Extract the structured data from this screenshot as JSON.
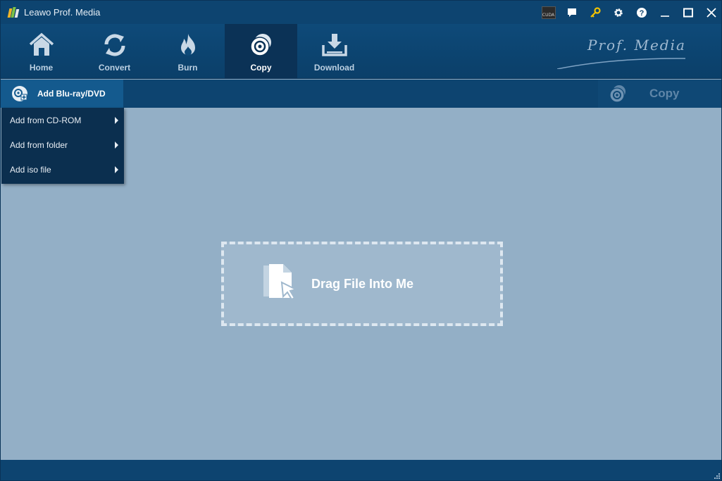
{
  "window": {
    "title": "Leawo Prof. Media"
  },
  "title_controls": [
    {
      "name": "cuda-icon",
      "text": "CUDA"
    },
    {
      "name": "chat-icon"
    },
    {
      "name": "key-icon"
    },
    {
      "name": "gear-icon"
    },
    {
      "name": "help-icon"
    },
    {
      "name": "minimize-icon"
    },
    {
      "name": "maximize-icon"
    },
    {
      "name": "close-icon"
    }
  ],
  "toolbar": {
    "tabs": [
      {
        "label": "Home",
        "icon": "home-icon"
      },
      {
        "label": "Convert",
        "icon": "convert-icon"
      },
      {
        "label": "Burn",
        "icon": "burn-icon"
      },
      {
        "label": "Copy",
        "icon": "disc-copy-icon",
        "active": true
      },
      {
        "label": "Download",
        "icon": "download-icon"
      }
    ],
    "brand": "Prof. Media"
  },
  "subbar": {
    "add_label": "Add Blu-ray/DVD",
    "copy_label": "Copy"
  },
  "menu": {
    "items": [
      {
        "label": "Add from CD-ROM"
      },
      {
        "label": "Add from folder"
      },
      {
        "label": "Add iso file"
      }
    ]
  },
  "dropzone": {
    "label": "Drag File Into Me"
  },
  "colors": {
    "titlebar": "#0d4470",
    "content_bg": "#93afc6",
    "menu_bg": "#0b2f4f",
    "key_icon": "#f2c200"
  }
}
